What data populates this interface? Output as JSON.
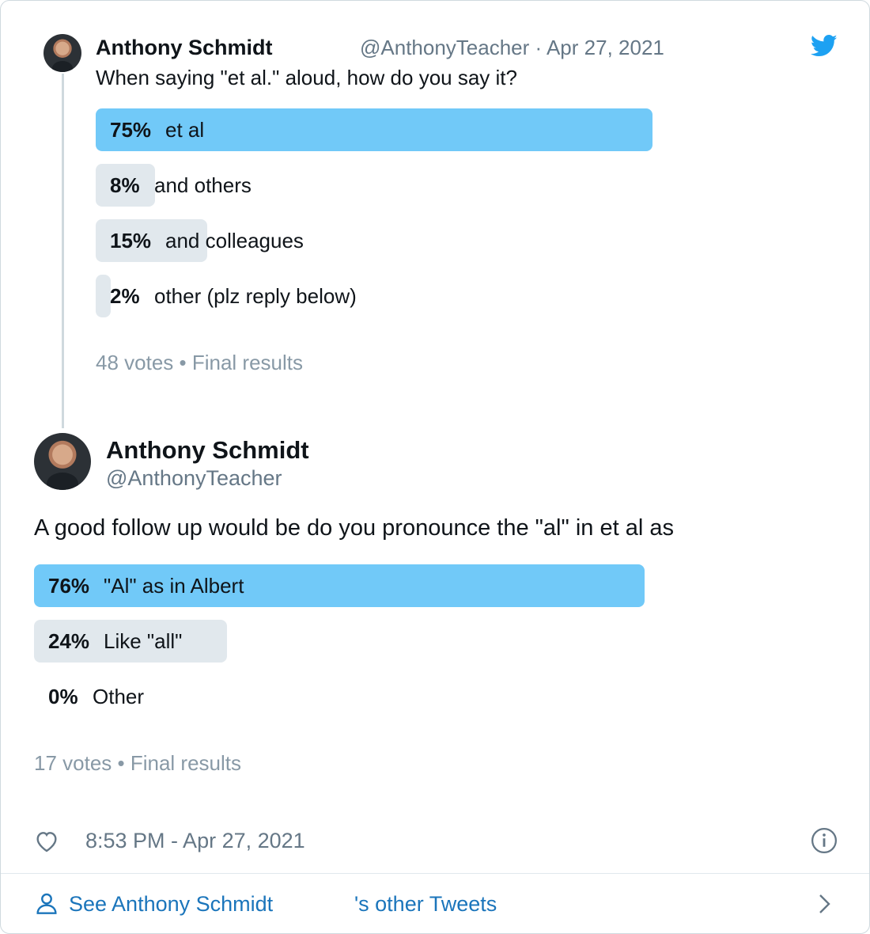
{
  "colors": {
    "accent": "#1DA1F2",
    "poll_winner": "#71C9F8",
    "poll_other": "#E1E8ED",
    "muted_text": "#657786",
    "link": "#1B75BB"
  },
  "parent_tweet": {
    "author_name": "Anthony Schmidt",
    "meta": "@AnthonyTeacher · Apr 27, 2021",
    "text": "When saying \"et al.\" aloud, how do you say it?",
    "poll": {
      "options": [
        {
          "percent": 75,
          "percent_label": "75%",
          "label": "et al",
          "winner": true
        },
        {
          "percent": 8,
          "percent_label": "8%",
          "label": "and others",
          "winner": false
        },
        {
          "percent": 15,
          "percent_label": "15%",
          "label": "and colleagues",
          "winner": false
        },
        {
          "percent": 2,
          "percent_label": "2%",
          "label": "other (plz reply below)",
          "winner": false
        }
      ],
      "footer": "48 votes • Final results"
    }
  },
  "main_tweet": {
    "author_name": "Anthony Schmidt",
    "handle": "@AnthonyTeacher",
    "text": "A good follow up would be do you pronounce the \"al\" in et al as",
    "poll": {
      "options": [
        {
          "percent": 76,
          "percent_label": "76%",
          "label": "\"Al\" as in Albert",
          "winner": true
        },
        {
          "percent": 24,
          "percent_label": "24%",
          "label": "Like \"all\"",
          "winner": false
        },
        {
          "percent": 0,
          "percent_label": "0%",
          "label": "Other",
          "winner": false
        }
      ],
      "footer": "17 votes • Final results"
    },
    "timestamp": "8:53 PM - Apr 27, 2021"
  },
  "footer": {
    "link_name": "See Anthony Schmidt",
    "link_suffix": "'s other Tweets"
  },
  "icons": [
    "twitter-bird-icon",
    "heart-icon",
    "info-icon",
    "person-icon",
    "chevron-right-icon"
  ]
}
